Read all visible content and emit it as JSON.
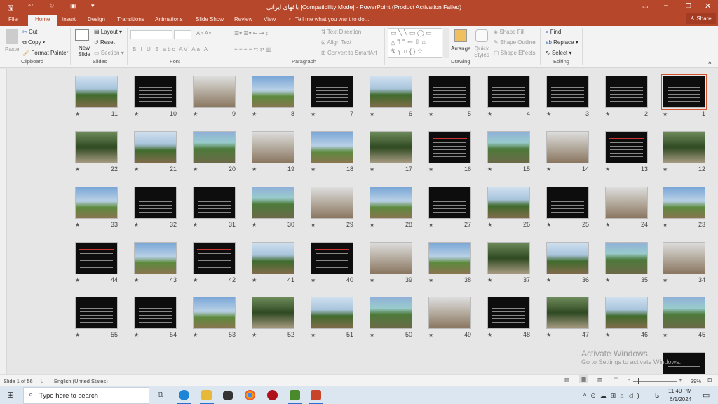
{
  "window": {
    "title": "باغهای ایرانی [Compatibility Mode] - PowerPoint (Product Activation Failed)",
    "share": "Share"
  },
  "tabs": [
    "File",
    "Home",
    "Insert",
    "Design",
    "Transitions",
    "Animations",
    "Slide Show",
    "Review",
    "View"
  ],
  "active_tab": "Home",
  "tell_me": "Tell me what you want to do...",
  "ribbon": {
    "clipboard": {
      "label": "Clipboard",
      "paste": "Paste",
      "cut": "Cut",
      "copy": "Copy",
      "format_painter": "Format Painter"
    },
    "slides": {
      "label": "Slides",
      "new_slide": "New Slide",
      "layout": "Layout",
      "reset": "Reset",
      "section": "Section"
    },
    "font": {
      "label": "Font",
      "font_name": "",
      "font_size": "",
      "buttons": [
        "B",
        "I",
        "U",
        "S",
        "abc",
        "AV",
        "Aa",
        "A"
      ]
    },
    "paragraph": {
      "label": "Paragraph",
      "text_direction": "Text Direction",
      "align_text": "Align Text",
      "convert_smartart": "Convert to SmartArt"
    },
    "drawing": {
      "label": "Drawing",
      "arrange": "Arrange",
      "quick_styles": "Quick Styles",
      "shape_fill": "Shape Fill",
      "shape_outline": "Shape Outline",
      "shape_effects": "Shape Effects"
    },
    "editing": {
      "label": "Editing",
      "find": "Find",
      "replace": "Replace",
      "select": "Select"
    }
  },
  "slides": {
    "selected": 1,
    "rows": [
      [
        {
          "n": "11",
          "k": "photo"
        },
        {
          "n": "10",
          "k": "text"
        },
        {
          "n": "9",
          "k": "photo"
        },
        {
          "n": "8",
          "k": "photo"
        },
        {
          "n": "7",
          "k": "text"
        },
        {
          "n": "6",
          "k": "photo"
        },
        {
          "n": "5",
          "k": "text"
        },
        {
          "n": "4",
          "k": "text"
        },
        {
          "n": "3",
          "k": "text"
        },
        {
          "n": "2",
          "k": "text"
        },
        {
          "n": "1",
          "k": "text"
        }
      ],
      [
        {
          "n": "22",
          "k": "photo"
        },
        {
          "n": "21",
          "k": "photo"
        },
        {
          "n": "20",
          "k": "photo"
        },
        {
          "n": "19",
          "k": "photo"
        },
        {
          "n": "18",
          "k": "photo"
        },
        {
          "n": "17",
          "k": "photo"
        },
        {
          "n": "16",
          "k": "text"
        },
        {
          "n": "15",
          "k": "photo"
        },
        {
          "n": "14",
          "k": "photo"
        },
        {
          "n": "13",
          "k": "text"
        },
        {
          "n": "12",
          "k": "photo"
        }
      ],
      [
        {
          "n": "33",
          "k": "photo"
        },
        {
          "n": "32",
          "k": "text"
        },
        {
          "n": "31",
          "k": "text"
        },
        {
          "n": "30",
          "k": "photo"
        },
        {
          "n": "29",
          "k": "photo"
        },
        {
          "n": "28",
          "k": "photo"
        },
        {
          "n": "27",
          "k": "text"
        },
        {
          "n": "26",
          "k": "photo"
        },
        {
          "n": "25",
          "k": "text"
        },
        {
          "n": "24",
          "k": "photo"
        },
        {
          "n": "23",
          "k": "photo"
        }
      ],
      [
        {
          "n": "44",
          "k": "text"
        },
        {
          "n": "43",
          "k": "photo"
        },
        {
          "n": "42",
          "k": "text"
        },
        {
          "n": "41",
          "k": "photo"
        },
        {
          "n": "40",
          "k": "text"
        },
        {
          "n": "39",
          "k": "photo"
        },
        {
          "n": "38",
          "k": "photo"
        },
        {
          "n": "37",
          "k": "photo"
        },
        {
          "n": "36",
          "k": "photo"
        },
        {
          "n": "35",
          "k": "photo"
        },
        {
          "n": "34",
          "k": "photo"
        }
      ],
      [
        {
          "n": "55",
          "k": "text"
        },
        {
          "n": "54",
          "k": "text"
        },
        {
          "n": "53",
          "k": "photo"
        },
        {
          "n": "52",
          "k": "photo"
        },
        {
          "n": "51",
          "k": "photo"
        },
        {
          "n": "50",
          "k": "photo"
        },
        {
          "n": "49",
          "k": "photo"
        },
        {
          "n": "48",
          "k": "text"
        },
        {
          "n": "47",
          "k": "photo"
        },
        {
          "n": "46",
          "k": "photo"
        },
        {
          "n": "45",
          "k": "photo"
        }
      ]
    ]
  },
  "watermark": {
    "line1": "Activate Windows",
    "line2": "Go to Settings to activate Windows."
  },
  "status": {
    "slide": "Slide 1 of 56",
    "language": "English (United States)",
    "zoom": "39%"
  },
  "taskbar": {
    "search_placeholder": "Type here to search",
    "time": "11:49 PM",
    "date": "6/1/2024"
  },
  "colors": {
    "accent": "#b7472a",
    "selection": "#d35230"
  }
}
